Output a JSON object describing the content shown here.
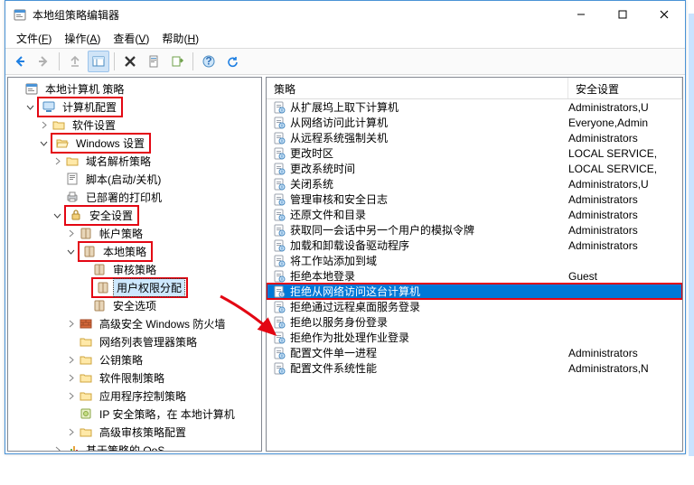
{
  "window": {
    "title": "本地组策略编辑器"
  },
  "menu": {
    "file": "文件",
    "file_k": "F",
    "action": "操作",
    "action_k": "A",
    "view": "查看",
    "view_k": "V",
    "help": "帮助",
    "help_k": "H"
  },
  "tree": {
    "root": "本地计算机 策略",
    "n0": "计算机配置",
    "n1": "软件设置",
    "n2": "Windows 设置",
    "n3": "域名解析策略",
    "n4": "脚本(启动/关机)",
    "n5": "已部署的打印机",
    "n6": "安全设置",
    "n7": "帐户策略",
    "n8": "本地策略",
    "n9": "审核策略",
    "n10": "用户权限分配",
    "n11": "安全选项",
    "n12": "高级安全 Windows 防火墙",
    "n13": "网络列表管理器策略",
    "n14": "公钥策略",
    "n15": "软件限制策略",
    "n16": "应用程序控制策略",
    "n17": "IP 安全策略，在 本地计算机",
    "n18": "高级审核策略配置",
    "n19": "基于策略的 QoS"
  },
  "headers": {
    "c1": "策略",
    "c2": "安全设置"
  },
  "rows": [
    {
      "p": "从扩展坞上取下计算机",
      "s": "Administrators,U"
    },
    {
      "p": "从网络访问此计算机",
      "s": "Everyone,Admin"
    },
    {
      "p": "从远程系统强制关机",
      "s": "Administrators"
    },
    {
      "p": "更改时区",
      "s": "LOCAL SERVICE,"
    },
    {
      "p": "更改系统时间",
      "s": "LOCAL SERVICE,"
    },
    {
      "p": "关闭系统",
      "s": "Administrators,U"
    },
    {
      "p": "管理审核和安全日志",
      "s": "Administrators"
    },
    {
      "p": "还原文件和目录",
      "s": "Administrators"
    },
    {
      "p": "获取同一会话中另一个用户的模拟令牌",
      "s": "Administrators"
    },
    {
      "p": "加载和卸载设备驱动程序",
      "s": "Administrators"
    },
    {
      "p": "将工作站添加到域",
      "s": ""
    },
    {
      "p": "拒绝本地登录",
      "s": "Guest"
    },
    {
      "p": "拒绝从网络访问这台计算机",
      "s": "",
      "sel": true
    },
    {
      "p": "拒绝通过远程桌面服务登录",
      "s": ""
    },
    {
      "p": "拒绝以服务身份登录",
      "s": ""
    },
    {
      "p": "拒绝作为批处理作业登录",
      "s": ""
    },
    {
      "p": "配置文件单一进程",
      "s": "Administrators"
    },
    {
      "p": "配置文件系统性能",
      "s": "Administrators,N"
    }
  ]
}
